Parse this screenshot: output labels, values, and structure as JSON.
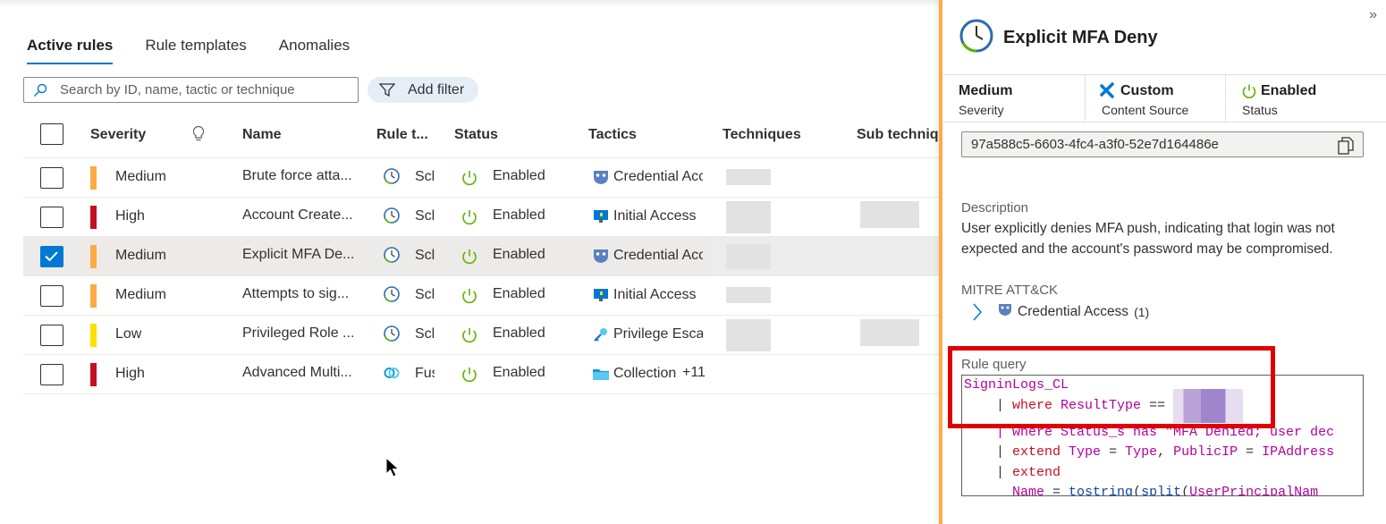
{
  "tabs": [
    {
      "label": "Active rules",
      "active": true
    },
    {
      "label": "Rule templates",
      "active": false
    },
    {
      "label": "Anomalies",
      "active": false
    }
  ],
  "search": {
    "placeholder": "Search by ID, name, tactic or technique"
  },
  "add_filter_label": "Add filter",
  "columns": {
    "severity": "Severity",
    "name": "Name",
    "rule_type": "Rule t...",
    "status": "Status",
    "tactics": "Tactics",
    "techniques": "Techniques",
    "sub_techniques": "Sub techniqu"
  },
  "rows": [
    {
      "severity": "Medium",
      "severity_color": "#ffaa44",
      "name": "Brute force atta...",
      "rule_type": "Scl",
      "status": "Enabled",
      "tactic": "Credential Acc",
      "tactic_icon": "mask-icon",
      "rule_type_icon": "clock-icon",
      "checked": false
    },
    {
      "severity": "High",
      "severity_color": "#c50f1f",
      "name": "Account Create...",
      "rule_type": "Scl",
      "status": "Enabled",
      "tactic": "Initial Access",
      "tactic_icon": "monitor-icon",
      "rule_type_icon": "clock-icon",
      "checked": false
    },
    {
      "severity": "Medium",
      "severity_color": "#ffaa44",
      "name": "Explicit MFA De...",
      "rule_type": "Scl",
      "status": "Enabled",
      "tactic": "Credential Acc",
      "tactic_icon": "mask-icon",
      "rule_type_icon": "clock-icon",
      "checked": true
    },
    {
      "severity": "Medium",
      "severity_color": "#ffaa44",
      "name": "Attempts to sig...",
      "rule_type": "Scl",
      "status": "Enabled",
      "tactic": "Initial Access",
      "tactic_icon": "monitor-icon",
      "rule_type_icon": "clock-icon",
      "checked": false
    },
    {
      "severity": "Low",
      "severity_color": "#fce100",
      "name": "Privileged Role ...",
      "rule_type": "Scl",
      "status": "Enabled",
      "tactic": "Privilege Esca",
      "tactic_icon": "key-icon",
      "rule_type_icon": "clock-icon",
      "checked": false
    },
    {
      "severity": "High",
      "severity_color": "#c50f1f",
      "name": "Advanced Multi...",
      "rule_type": "Fus",
      "status": "Enabled",
      "tactic": "Collection",
      "tactic_extra": "+11",
      "tactic_icon": "folder-icon",
      "rule_type_icon": "fusion-icon",
      "checked": false
    }
  ],
  "panel": {
    "title": "Explicit MFA Deny",
    "severity_value": "Medium",
    "severity_label": "Severity",
    "source_value": "Custom",
    "source_label": "Content Source",
    "status_value": "Enabled",
    "status_label": "Status",
    "rule_id": "97a588c5-6603-4fc4-a3f0-52e7d164486e",
    "description_label": "Description",
    "description": "User explicitly denies MFA push, indicating that login was not expected and the account's password may be compromised.",
    "mitre_label": "MITRE ATT&CK",
    "mitre_tactic": "Credential Access",
    "mitre_count": "(1)",
    "query_label": "Rule query",
    "query": {
      "l1": "SigninLogs_CL",
      "l2_pipe": "    | ",
      "l2_kw": "where",
      "l2_fld": "ResultType",
      "l2_op": " == ",
      "l3": "    | where Status_s has \"MFA Denied; user dec",
      "l4_pipe": "    | ",
      "l4_kw": "extend",
      "l4_a": "Type",
      "l4_b": "Type",
      "l4_c": "PublicIP",
      "l4_d": "IPAddress",
      "l5_pipe": "    | ",
      "l5_kw": "extend",
      "l6_fld": "Name",
      "l6_fn": "tostring",
      "l6_fn2": "split",
      "l6_arg": "UserPrincipalNam"
    }
  },
  "colors": {
    "accent": "#0078d4",
    "medium": "#ffaa44",
    "high": "#c50f1f",
    "low": "#fce100",
    "enabled": "#5db300",
    "highlight": "#e00000"
  }
}
